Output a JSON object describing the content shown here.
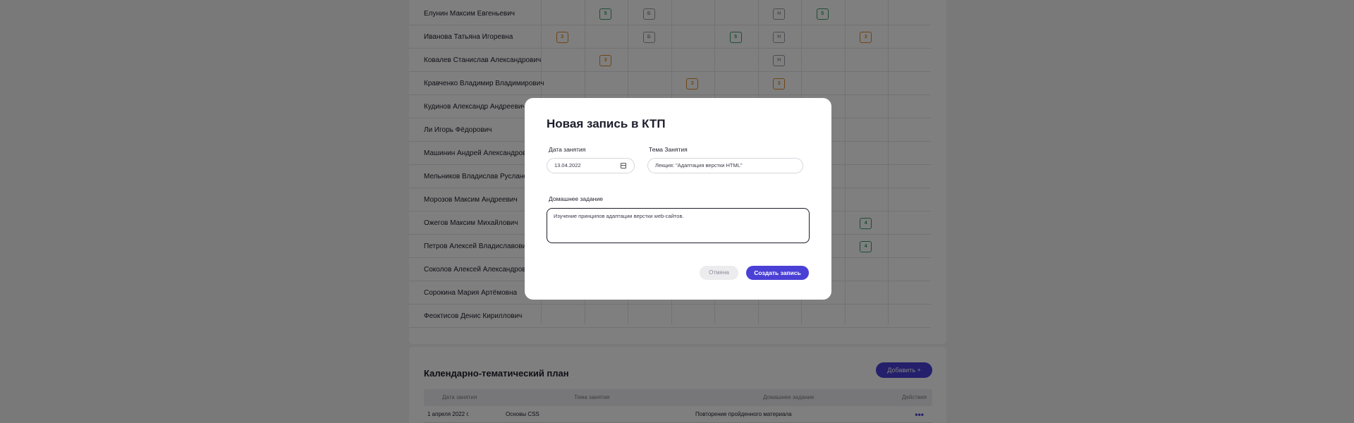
{
  "students": [
    "Елунин Максим Евгеньевич",
    "Иванова Татьяна Игоревна",
    "Ковалев Станислав Александрович",
    "Кравченко Владимир Владимирович",
    "Кудинов Александр Андреевич",
    "Ли Игорь Фёдорович",
    "Машинин Андрей Александрович",
    "Мельников Владислав Русланович",
    "Морозов Максим Андреевич",
    "Ожегов Максим Михайлович",
    "Петров Алексей Владиславович",
    "Соколов Алексей Александрович",
    "Сорокина Мария Артёмовна",
    "Феоктисов Денис Кириллович"
  ],
  "marks": [
    {
      "student": 0,
      "col": 1,
      "value": "5",
      "kind": "good"
    },
    {
      "student": 0,
      "col": 2,
      "value": "Б",
      "kind": "absent"
    },
    {
      "student": 0,
      "col": 5,
      "value": "Н",
      "kind": "absent"
    },
    {
      "student": 0,
      "col": 6,
      "value": "5",
      "kind": "good"
    },
    {
      "student": 1,
      "col": 0,
      "value": "3",
      "kind": "warn"
    },
    {
      "student": 1,
      "col": 2,
      "value": "Б",
      "kind": "absent"
    },
    {
      "student": 1,
      "col": 4,
      "value": "5",
      "kind": "good"
    },
    {
      "student": 1,
      "col": 5,
      "value": "Н",
      "kind": "absent"
    },
    {
      "student": 1,
      "col": 7,
      "value": "3",
      "kind": "warn"
    },
    {
      "student": 2,
      "col": 1,
      "value": "3",
      "kind": "warn"
    },
    {
      "student": 2,
      "col": 5,
      "value": "Н",
      "kind": "absent"
    },
    {
      "student": 3,
      "col": 3,
      "value": "3",
      "kind": "warn"
    },
    {
      "student": 3,
      "col": 5,
      "value": "3",
      "kind": "warn"
    },
    {
      "student": 9,
      "col": 7,
      "value": "4",
      "kind": "good"
    },
    {
      "student": 10,
      "col": 7,
      "value": "4",
      "kind": "good"
    }
  ],
  "mark_colors": {
    "good": "#3a9a6a",
    "warn": "#e08a2c",
    "absent": "#9a9aa5"
  },
  "ktp": {
    "title": "Календарно-тематический план",
    "add_label": "Добавить +",
    "columns": [
      "Дата занятия",
      "Тема занятия",
      "Домашнее задание",
      "Действия"
    ],
    "row": {
      "date": "1 апреля 2022 г.",
      "topic": "Основы CSS",
      "homework": "Повторение пройденного материала",
      "actions": "•••"
    }
  },
  "modal": {
    "title": "Новая запись в КТП",
    "date_label": "Дата занятия",
    "date_value": "13.04.2022",
    "topic_label": "Тема Занятия",
    "topic_value": "Лекция: \"Адаптация верстки HTML\"",
    "homework_label": "Домашнее задание",
    "homework_value": "Изучение принципов адаптации верстки web-сайтов.",
    "cancel_label": "Отмена",
    "create_label": "Создать запись"
  },
  "accent_color": "#4a40d6"
}
